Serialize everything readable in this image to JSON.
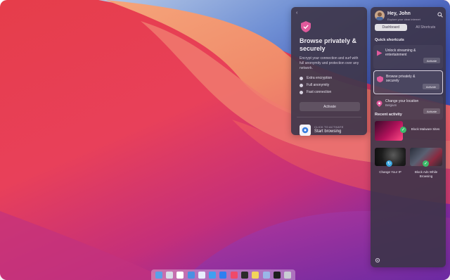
{
  "popup": {
    "back": "‹",
    "title": "Browse privately & securely",
    "description": "Encrypt your connection and surf with full anonymity and protection over any network.",
    "features": [
      "Extra encryption",
      "Full anonymity",
      "Fast connection"
    ],
    "activate_label": "Activate",
    "click_hint": "CLICK TO ACTIVATE",
    "start_label": "Start browsing"
  },
  "sidebar": {
    "greeting": "Hey, John",
    "subgreeting": "Explore your clear internet",
    "tabs": [
      "Dashboard",
      "All Shortcuts"
    ],
    "active_tab": "Dashboard",
    "quick_shortcuts_title": "Quick shortcuts",
    "shortcuts": [
      {
        "label": "Unlock streaming & entertainment",
        "sub": "",
        "button": "Activate"
      },
      {
        "label": "Browse privately & securely",
        "sub": "",
        "button": "Activate"
      },
      {
        "label": "Change your location",
        "sub": "Belgium",
        "button": "Activate"
      }
    ],
    "recent_title": "Recent activity",
    "activities": [
      {
        "label": "Block Malware Sites"
      },
      {
        "label": "Change Your IP"
      },
      {
        "label": "Block Ads While Browsing"
      }
    ]
  },
  "colors": {
    "accent": "#e05a9c",
    "green_badge": "#3dbb6b",
    "blue_badge": "#3aa6e0",
    "panel": "#3c3448"
  }
}
